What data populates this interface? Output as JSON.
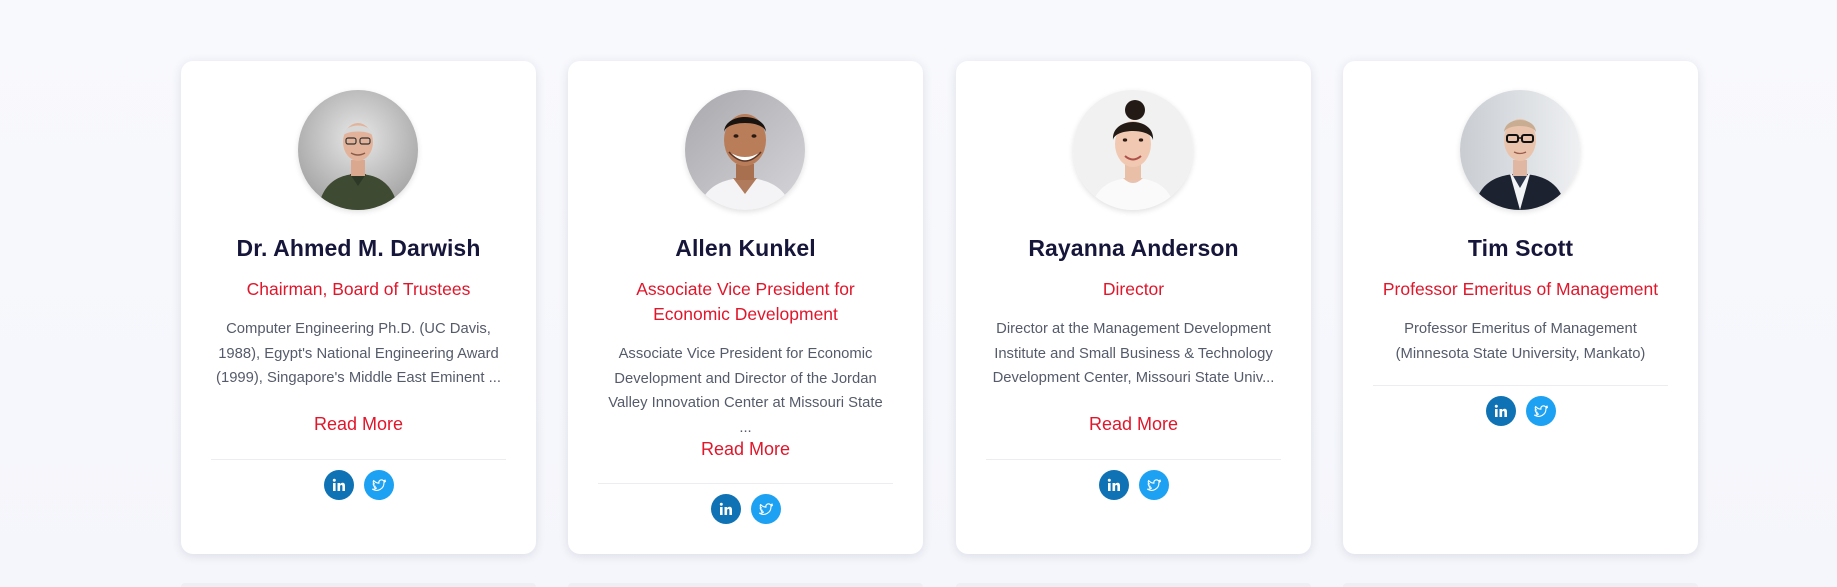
{
  "team": [
    {
      "name": "Dr. Ahmed M. Darwish",
      "role": "Chairman, Board of Trustees",
      "bio": "Computer Engineering Ph.D. (UC Davis, 1988), Egypt's National Engineering Award (1999), Singapore's Middle East Eminent ...",
      "read_more": "Read More",
      "avatar_icon": "portrait-older-man-icon"
    },
    {
      "name": "Allen Kunkel",
      "role": "Associate Vice President for Economic Development",
      "bio": "Associate Vice President for Economic Development and Director of the Jordan Valley Innovation Center at Missouri State ...",
      "read_more": "Read More",
      "avatar_icon": "portrait-smiling-man-icon"
    },
    {
      "name": "Rayanna Anderson",
      "role": "Director",
      "bio": "Director at the Management Development Institute and Small Business & Technology Development Center, Missouri State Univ...",
      "read_more": "Read More",
      "avatar_icon": "portrait-woman-icon"
    },
    {
      "name": "Tim Scott",
      "role": "Professor Emeritus of Management",
      "bio": "Professor Emeritus of Management (Minnesota State University, Mankato)",
      "read_more": "",
      "avatar_icon": "portrait-man-glasses-icon"
    }
  ],
  "social_icons": [
    "linkedin-icon",
    "twitter-icon"
  ],
  "colors": {
    "accent": "#e0162b",
    "name_text": "#16163a",
    "bio_text": "#555b6a",
    "linkedin": "#0e72b5",
    "twitter": "#1da1f2"
  }
}
